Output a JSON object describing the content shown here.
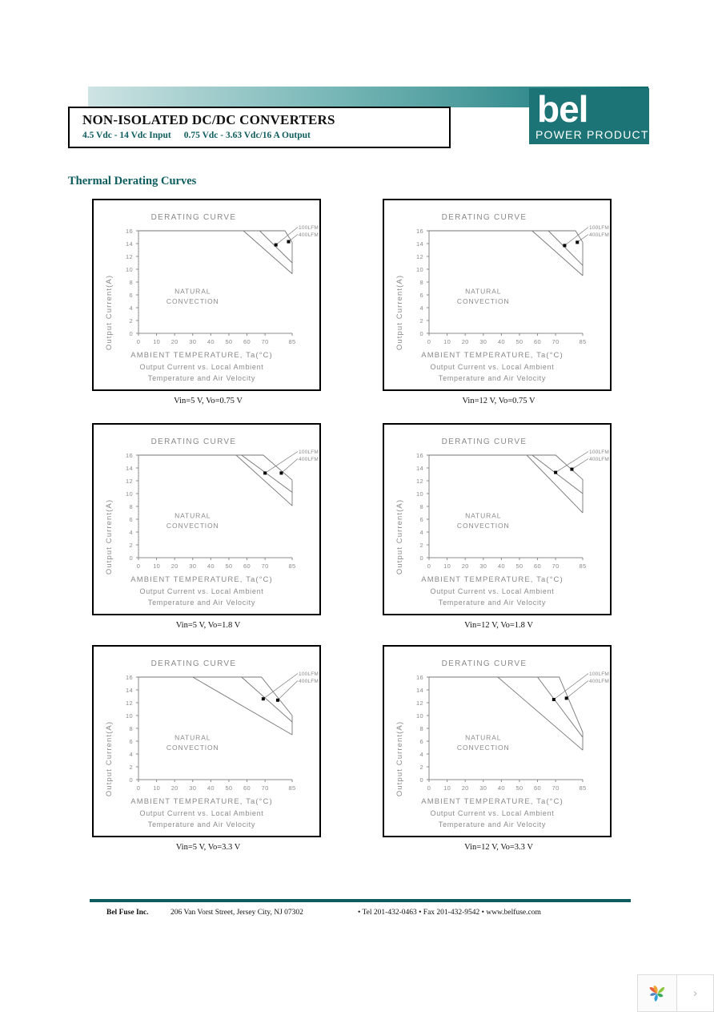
{
  "header": {
    "title_main": "NON-ISOLATED DC/DC CONVERTERS",
    "input_spec": "4.5 Vdc - 14 Vdc Input",
    "output_spec": "0.75 Vdc - 3.63 Vdc/16 A Output",
    "gradient_from": "#cfe4e4",
    "gradient_to": "#0d6a6d"
  },
  "brand": {
    "wordmark": "bel",
    "tagline": "POWER PRODUCTS",
    "color": "#1d7476"
  },
  "section": {
    "heading": "Thermal Derating Curves",
    "heading_color": "#0d5c5e"
  },
  "footer": {
    "company": "Bel Fuse Inc.",
    "address": "206 Van Vorst Street, Jersey City, NJ 07302",
    "contact": "• Tel 201-432-0463 • Fax 201-432-9542 • www.belfuse.com",
    "rule_color": "#0d5c5e"
  },
  "corner_widget": {
    "logo_icon": "leaf-logo-icon",
    "next_icon": "chevron-right-icon",
    "next_glyph": "›"
  },
  "chart_common": {
    "title": "DERATING CURVE",
    "xlabel": "AMBIENT TEMPERATURE, Ta(°C)",
    "ylabel": "Output Current(A)",
    "sub1": "Output Current vs. Local Ambient",
    "sub2": "Temperature and Air Velocity",
    "region_label_1": "NATURAL",
    "region_label_2": "CONVECTION",
    "legend": [
      "100LFM",
      "400LFM"
    ],
    "xticks": [
      0,
      10,
      20,
      30,
      40,
      50,
      60,
      70,
      85
    ],
    "yticks": [
      0,
      2,
      4,
      6,
      8,
      10,
      12,
      14,
      16
    ],
    "xlim": [
      0,
      85
    ],
    "ylim": [
      0,
      16
    ]
  },
  "chart_data": [
    {
      "id": "chart-vin5-vo075",
      "type": "line",
      "title": "DERATING CURVE",
      "caption": "Vin=5 V, Vo=0.75 V",
      "xlabel": "AMBIENT TEMPERATURE, Ta(°C)",
      "ylabel": "Output Current(A)",
      "xlim": [
        0,
        85
      ],
      "ylim": [
        0,
        16
      ],
      "grid": false,
      "series": [
        {
          "name": "NATURAL CONVECTION",
          "x": [
            0,
            58,
            85
          ],
          "y": [
            16,
            16,
            9.3
          ]
        },
        {
          "name": "100LFM",
          "x": [
            0,
            67,
            85
          ],
          "y": [
            16,
            16,
            11.0
          ]
        },
        {
          "name": "400LFM",
          "x": [
            0,
            81,
            85
          ],
          "y": [
            16,
            16,
            14.2
          ]
        }
      ],
      "markers": [
        {
          "label": "100LFM",
          "x": 76,
          "y": 13.8
        },
        {
          "label": "400LFM",
          "x": 83,
          "y": 14.3
        }
      ]
    },
    {
      "id": "chart-vin12-vo075",
      "type": "line",
      "title": "DERATING CURVE",
      "caption": "Vin=12 V, Vo=0.75 V",
      "xlabel": "AMBIENT TEMPERATURE, Ta(°C)",
      "ylabel": "Output Current(A)",
      "xlim": [
        0,
        85
      ],
      "ylim": [
        0,
        16
      ],
      "grid": false,
      "series": [
        {
          "name": "NATURAL CONVECTION",
          "x": [
            0,
            57,
            85
          ],
          "y": [
            16,
            16,
            9.0
          ]
        },
        {
          "name": "100LFM",
          "x": [
            0,
            66,
            85
          ],
          "y": [
            16,
            16,
            10.6
          ]
        },
        {
          "name": "400LFM",
          "x": [
            0,
            81,
            85
          ],
          "y": [
            16,
            16,
            14.2
          ]
        }
      ],
      "markers": [
        {
          "label": "100LFM",
          "x": 75,
          "y": 13.7
        },
        {
          "label": "400LFM",
          "x": 82,
          "y": 14.2
        }
      ]
    },
    {
      "id": "chart-vin5-vo18",
      "type": "line",
      "title": "DERATING CURVE",
      "caption": "Vin=5 V, Vo=1.8 V",
      "xlabel": "AMBIENT TEMPERATURE, Ta(°C)",
      "ylabel": "Output Current(A)",
      "xlim": [
        0,
        85
      ],
      "ylim": [
        0,
        16
      ],
      "grid": false,
      "series": [
        {
          "name": "NATURAL CONVECTION",
          "x": [
            0,
            54,
            85
          ],
          "y": [
            16,
            16,
            8.1
          ]
        },
        {
          "name": "100LFM",
          "x": [
            0,
            57,
            85
          ],
          "y": [
            16,
            16,
            10.2
          ]
        },
        {
          "name": "400LFM",
          "x": [
            0,
            69,
            85
          ],
          "y": [
            16,
            16,
            12.1
          ]
        }
      ],
      "markers": [
        {
          "label": "100LFM",
          "x": 70,
          "y": 13.2
        },
        {
          "label": "400LFM",
          "x": 79,
          "y": 13.2
        }
      ]
    },
    {
      "id": "chart-vin12-vo18",
      "type": "line",
      "title": "DERATING CURVE",
      "caption": "Vin=12 V, Vo=1.8 V",
      "xlabel": "AMBIENT TEMPERATURE, Ta(°C)",
      "ylabel": "Output Current(A)",
      "xlim": [
        0,
        85
      ],
      "ylim": [
        0,
        16
      ],
      "grid": false,
      "series": [
        {
          "name": "NATURAL CONVECTION",
          "x": [
            0,
            54,
            85
          ],
          "y": [
            16,
            16,
            7.0
          ]
        },
        {
          "name": "100LFM",
          "x": [
            0,
            57,
            85
          ],
          "y": [
            16,
            16,
            10.0
          ]
        },
        {
          "name": "400LFM",
          "x": [
            0,
            70,
            85
          ],
          "y": [
            16,
            16,
            12.2
          ]
        }
      ],
      "markers": [
        {
          "label": "100LFM",
          "x": 70,
          "y": 13.3
        },
        {
          "label": "400LFM",
          "x": 79,
          "y": 13.8
        }
      ]
    },
    {
      "id": "chart-vin5-vo33",
      "type": "line",
      "title": "DERATING CURVE",
      "caption": "Vin=5 V, Vo=3.3 V",
      "xlabel": "AMBIENT TEMPERATURE, Ta(°C)",
      "ylabel": "Output Current(A)",
      "xlim": [
        0,
        85
      ],
      "ylim": [
        0,
        16
      ],
      "grid": false,
      "series": [
        {
          "name": "NATURAL CONVECTION",
          "x": [
            0,
            30,
            85
          ],
          "y": [
            16,
            16,
            7.0
          ]
        },
        {
          "name": "100LFM",
          "x": [
            0,
            57,
            85
          ],
          "y": [
            16,
            16,
            9.0
          ]
        },
        {
          "name": "400LFM",
          "x": [
            0,
            68,
            85
          ],
          "y": [
            16,
            16,
            10.0
          ]
        }
      ],
      "markers": [
        {
          "label": "100LFM",
          "x": 69,
          "y": 12.6
        },
        {
          "label": "400LFM",
          "x": 77,
          "y": 12.4
        }
      ]
    },
    {
      "id": "chart-vin12-vo33",
      "type": "line",
      "title": "DERATING CURVE",
      "caption": "Vin=12 V, Vo=3.3 V",
      "xlabel": "AMBIENT TEMPERATURE, Ta(°C)",
      "ylabel": "Output Current(A)",
      "xlim": [
        0,
        85
      ],
      "ylim": [
        0,
        16
      ],
      "grid": false,
      "series": [
        {
          "name": "NATURAL CONVECTION",
          "x": [
            0,
            38,
            85
          ],
          "y": [
            16,
            16,
            4.6
          ]
        },
        {
          "name": "100LFM",
          "x": [
            0,
            60,
            85
          ],
          "y": [
            16,
            16,
            6.6
          ]
        },
        {
          "name": "400LFM",
          "x": [
            0,
            72,
            85
          ],
          "y": [
            16,
            16,
            7.4
          ]
        }
      ],
      "markers": [
        {
          "label": "100LFM",
          "x": 69,
          "y": 12.5
        },
        {
          "label": "400LFM",
          "x": 76,
          "y": 12.7
        }
      ]
    }
  ]
}
